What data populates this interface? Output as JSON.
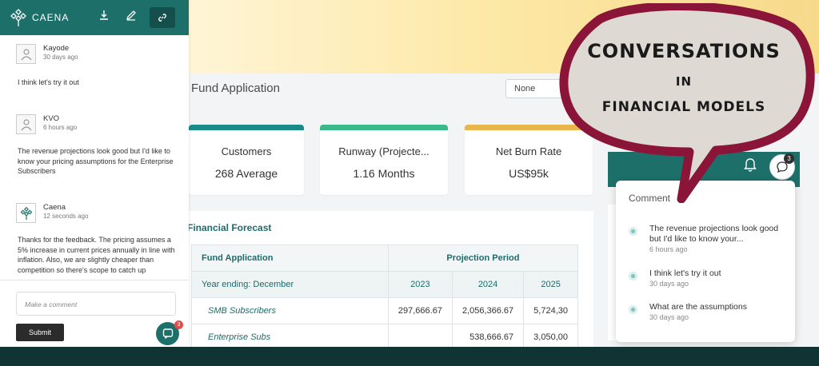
{
  "app": {
    "logo_text": "CAENA",
    "page_title": "Fund Application",
    "filter_select": "None"
  },
  "kpis": [
    {
      "label": "Customers",
      "value": "268 Average",
      "accent": "#1b8a8a"
    },
    {
      "label": "Runway (Projecte...",
      "value": "1.16 Months",
      "accent": "#3bb98a"
    },
    {
      "label": "Net Burn Rate",
      "value": "US$95k",
      "accent": "#e8b64b"
    }
  ],
  "forecast": {
    "title": "Financial Forecast",
    "header_left": "Fund Application",
    "header_right": "Projection Period",
    "sub_left": "Year ending: December",
    "years": [
      "2023",
      "2024",
      "2025"
    ],
    "rows": [
      {
        "label": "SMB Subscribers",
        "values": [
          "297,666.67",
          "2,056,366.67",
          "5,724,30"
        ]
      },
      {
        "label": "Enterprise Subs",
        "values": [
          "",
          "538,666.67",
          "3,050,00"
        ]
      }
    ]
  },
  "conversation": {
    "messages": [
      {
        "name": "Kayode",
        "time": "30 days ago",
        "body": "I think let's try it out"
      },
      {
        "name": "KVO",
        "time": "6 hours ago",
        "body": "The revenue projections look good but I'd like to know your pricing assumptions for the Enterprise Subscribers"
      },
      {
        "name": "Caena",
        "time": "12 seconds ago",
        "body": "Thanks for the feedback. The pricing assumes a 5% increase in current prices annually in line with inflation. Also, we are slightly cheaper than competition so there's scope to catch up"
      }
    ],
    "input_placeholder": "Make a comment",
    "submit_label": "Submit",
    "fab_badge": "3"
  },
  "comment_popup": {
    "title": "Comment",
    "badge": "3",
    "items": [
      {
        "text": "The revenue projections look good but I'd like to know your...",
        "time": "6 hours ago"
      },
      {
        "text": "I think let's try it out",
        "time": "30 days ago"
      },
      {
        "text": "What are the assumptions",
        "time": "30 days ago"
      }
    ]
  },
  "banner": {
    "line1": "CONVERSATIONS",
    "line2": "IN",
    "line3": "FINANCIAL MODELS",
    "bubble_color": "#8a1538",
    "bubble_fill": "#dedad3"
  }
}
